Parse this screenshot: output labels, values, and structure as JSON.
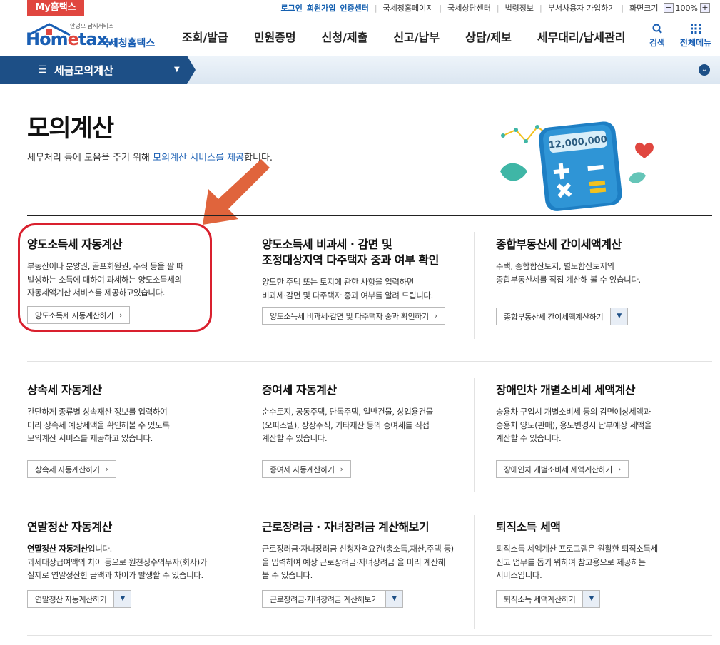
{
  "util": {
    "my_hometax": "My홈택스",
    "login": "로그인",
    "signup": "회원가입",
    "cert": "인증센터",
    "links": [
      "국세청홈페이지",
      "국세상담센터",
      "법령정보",
      "부서사용자 가입하기"
    ],
    "screen_size": "화면크기",
    "zoom_minus": "−",
    "zoom_value": "100%",
    "zoom_plus": "+"
  },
  "header": {
    "logo_sub": "안녕모 납세서비스",
    "logo_main_a": "Hom",
    "logo_main_e": "e",
    "logo_main_b": "tax.",
    "logo_kr": "국세청홈택스",
    "nav": [
      "조회/발급",
      "민원증명",
      "신청/제출",
      "신고/납부",
      "상담/제보",
      "세무대리/납세관리"
    ],
    "search_label": "검색",
    "all_menu_label": "전체메뉴",
    "search_icon": "search-icon",
    "grid_icon": "grid-menu-icon"
  },
  "subnav": {
    "title": "세금모의계산",
    "menu_glyph": "☰",
    "caret": "▼",
    "more": "⌄"
  },
  "page": {
    "title": "모의계산",
    "desc_pre": "세무처리 등에 도움을 주기 위해 ",
    "desc_hl": "모의계산 서비스를 제공",
    "desc_post": "합니다.",
    "hero_amount": "12,000,000"
  },
  "cards": [
    {
      "title": "양도소득세 자동계산",
      "desc": [
        "부동산이나 분양권, 골프회원권, 주식 등을 팔 때",
        "발생하는 소득에 대하여 과세하는 양도소득세의",
        "자동세액계산 서비스를 제공하고있습니다."
      ],
      "button": "양도소득세 자동계산하기"
    },
    {
      "title_lines": [
        "양도소득세 비과세 · 감면 및",
        "조정대상지역 다주택자 중과 여부 확인"
      ],
      "desc": [
        "양도한 주택 또는 토지에 관한 사항을 입력하면",
        "비과세·감면 및 다주택자 중과 여부를 알려 드립니다."
      ],
      "button": "양도소득세 비과세·감면 및 다주택자 중과 확인하기"
    },
    {
      "title": "종합부동산세 간이세액계산",
      "desc": [
        "주택, 종합합산토지, 별도합산토지의",
        "종합부동산세를 직접 계산해 볼 수 있습니다."
      ],
      "button": "종합부동산세 간이세액계산하기"
    },
    {
      "title": "상속세 자동계산",
      "desc": [
        "간단하게 종류별 상속재산 정보를 입력하여",
        "미리 상속세 예상세액을 확인해볼 수 있도록",
        "모의계산 서비스를 제공하고 있습니다."
      ],
      "button": "상속세 자동계산하기"
    },
    {
      "title": "증여세 자동계산",
      "desc": [
        "순수토지, 공동주택, 단독주택, 일반건물, 상업용건물",
        "(오피스텔), 상장주식, 기타재산 등의 증여세를 직접",
        "계산할 수 있습니다."
      ],
      "button": "증여세 자동계산하기"
    },
    {
      "title": "장애인차 개별소비세 세액계산",
      "desc": [
        "승용차 구입시 개별소비세 등의 감면예상세액과",
        "승용차 양도(판매), 용도변경시 납부예상 세액을",
        "계산할 수 있습니다."
      ],
      "button": "장애인차 개별소비세 세액계산하기"
    },
    {
      "title": "연말정산 자동계산",
      "desc_bold": "연말정산 자동계산",
      "desc_first_rest": "입니다.",
      "desc": [
        "과세대상급여액의 차이 등으로 원천징수의무자(회사)가",
        "실제로 연말정산한 금액과 차이가 발생할 수 있습니다."
      ],
      "button": "연말정산 자동계산하기"
    },
    {
      "title": "근로장려금 · 자녀장려금 계산해보기",
      "desc": [
        "근로장려금·자녀장려금 신청자격요건(총소득,재산,주택 등)",
        "을 입력하여 예상 근로장려금·자녀장려금 을 미리 계산해",
        "볼 수 있습니다."
      ],
      "button": "근로장려금·자녀장려금 계산해보기"
    },
    {
      "title": "퇴직소득 세액",
      "desc": [
        "퇴직소득 세액계산 프로그램은 원활한 퇴직소득세",
        "신고 업무를 돕기 위하여 참고용으로 제공하는",
        "서비스입니다."
      ],
      "button": "퇴직소득 세액계산하기"
    }
  ],
  "glyphs": {
    "chevron": "›",
    "dropdown": "▼"
  },
  "colors": {
    "brand_blue": "#1a5fb4",
    "nav_dark": "#1d4f86",
    "accent_red": "#e0463f",
    "annotation_red": "#d9202e",
    "annotation_arrow": "#e0643c"
  }
}
